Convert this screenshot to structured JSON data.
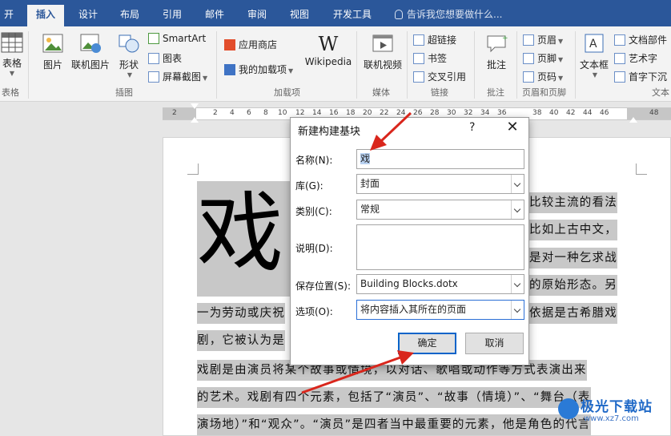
{
  "tabs": [
    {
      "label": "开始",
      "active": false
    },
    {
      "label": "插入",
      "active": true
    },
    {
      "label": "设计",
      "active": false
    },
    {
      "label": "布局",
      "active": false
    },
    {
      "label": "引用",
      "active": false
    },
    {
      "label": "邮件",
      "active": false
    },
    {
      "label": "审阅",
      "active": false
    },
    {
      "label": "视图",
      "active": false
    },
    {
      "label": "开发工具",
      "active": false
    }
  ],
  "tell_me": "告诉我您想要做什么...",
  "ribbon": {
    "table": {
      "label": "表格",
      "group": "表格"
    },
    "illustrations": {
      "group": "插图",
      "picture": "图片",
      "online_picture": "联机图片",
      "shapes": "形状",
      "smartart": "SmartArt",
      "chart": "图表",
      "screenshot": "屏幕截图"
    },
    "addins": {
      "group": "加载项",
      "store": "应用商店",
      "my_addins": "我的加载项",
      "wikipedia": "Wikipedia"
    },
    "media": {
      "group": "媒体",
      "online_video": "联机视频"
    },
    "links": {
      "group": "链接",
      "hyperlink": "超链接",
      "bookmark": "书签",
      "cross_ref": "交叉引用"
    },
    "comments": {
      "group": "批注",
      "comment": "批注"
    },
    "header_footer": {
      "group": "页眉和页脚",
      "header": "页眉",
      "footer": "页脚",
      "page_number": "页码"
    },
    "text": {
      "group": "文本",
      "text_box": "文本框",
      "doc_parts": "文档部件",
      "wordart": "艺术字",
      "dropcap": "首字下沉"
    }
  },
  "ruler_numbers": [
    "2",
    "2",
    "4",
    "6",
    "8",
    "10",
    "12",
    "14",
    "16",
    "18",
    "20",
    "22",
    "24",
    "26",
    "28",
    "30",
    "32",
    "34",
    "36",
    "38",
    "40",
    "42",
    "44",
    "46",
    "48"
  ],
  "document": {
    "drop_char": "戏",
    "lines": [
      "比较主流的看法",
      "比如上古中文，",
      "是对一种乞求战",
      "的原始形态。另",
      "一为劳动或庆祝",
      "依据是古希腊戏",
      "剧，它被认为是",
      "戏剧是由演员将某个故事或情境，以对话、歌唱或动作等方式表演出来",
      "的艺术。戏剧有四个元素，包括了“演员”、“故事（情境）”、“舞台（表",
      "演场地）”和“观众”。“演员”是四者当中最重要的元素，他是角色的代言"
    ]
  },
  "dialog": {
    "title": "新建构建基块",
    "help": "?",
    "close": "✕",
    "name_label": "名称(N):",
    "name_value": "戏",
    "gallery_label": "库(G):",
    "gallery_value": "封面",
    "category_label": "类别(C):",
    "category_value": "常规",
    "description_label": "说明(D):",
    "description_value": "",
    "save_in_label": "保存位置(S):",
    "save_in_value": "Building Blocks.dotx",
    "options_label": "选项(O):",
    "options_value": "将内容插入其所在的页面",
    "ok": "确定",
    "cancel": "取消"
  },
  "watermark": {
    "brand": "极光下载站",
    "url": "www.xz7.com"
  },
  "colors": {
    "accent": "#2b579a",
    "arrow": "#d9261c",
    "selection": "#c8c8c8"
  }
}
